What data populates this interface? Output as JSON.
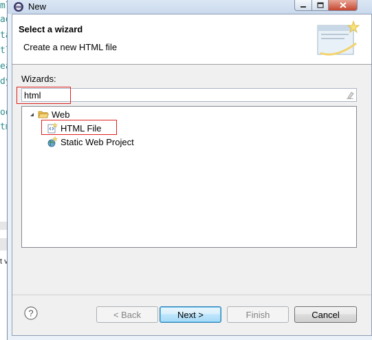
{
  "background_editor": {
    "code_fragments": [
      "ml",
      "ad",
      "ta",
      "tl",
      "ea",
      "dy",
      "od",
      "tm"
    ],
    "side_text": "t v"
  },
  "window": {
    "title": "New"
  },
  "header": {
    "title": "Select a wizard",
    "description": "Create a new HTML file"
  },
  "wizards": {
    "label": "Wizards:",
    "filter_value": "html",
    "tree": [
      {
        "label": "Web",
        "icon": "folder-open-icon",
        "expanded": true,
        "level": 0
      },
      {
        "label": "HTML File",
        "icon": "html-file-wizard-icon",
        "level": 1,
        "selected": true
      },
      {
        "label": "Static Web Project",
        "icon": "web-project-wizard-icon",
        "level": 1
      }
    ]
  },
  "buttons": {
    "help": "?",
    "back": "< Back",
    "next": "Next >",
    "finish": "Finish",
    "cancel": "Cancel"
  },
  "colors": {
    "annotation": "#e0201c",
    "default_button": "#3c7fb1"
  }
}
